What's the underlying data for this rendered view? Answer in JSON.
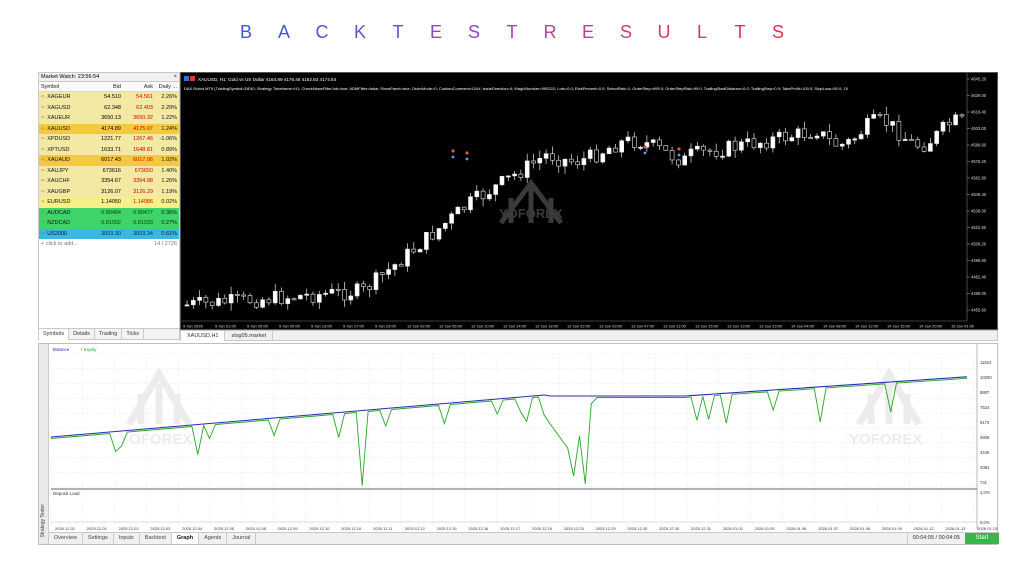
{
  "banner": {
    "letters": [
      {
        "ch": "B",
        "color": "#3b5bdb"
      },
      {
        "ch": "A",
        "color": "#4a56d6"
      },
      {
        "ch": "C",
        "color": "#5a52d2"
      },
      {
        "ch": "K",
        "color": "#6a4ece"
      },
      {
        "ch": "T",
        "color": "#7a4aca"
      },
      {
        "ch": "E",
        "color": "#8a47c4"
      },
      {
        "ch": "S",
        "color": "#9b44bd"
      },
      {
        "ch": "T",
        "color": "#ab40b3"
      },
      {
        "ch": "R",
        "color": "#b83ca6"
      },
      {
        "ch": "E",
        "color": "#c23a96"
      },
      {
        "ch": "S",
        "color": "#cc3786"
      },
      {
        "ch": "U",
        "color": "#d43476"
      },
      {
        "ch": "L",
        "color": "#da3266"
      },
      {
        "ch": "T",
        "color": "#df3158"
      },
      {
        "ch": "S",
        "color": "#e2304c"
      }
    ]
  },
  "market_watch": {
    "title": "Market Watch: 23:56:54",
    "close": "×",
    "columns": {
      "symbol": "Symbol",
      "bid": "Bid",
      "ask": "Ask",
      "daily": "Daily ..."
    },
    "rows": [
      {
        "symbol": "XAGEUR",
        "bid": "54.510",
        "ask": "54.561",
        "daily": "2.26%",
        "bg": "#f3e9a3",
        "bidc": "#000",
        "askc": "#d40000"
      },
      {
        "symbol": "XAGUSD",
        "bid": "62.348",
        "ask": "62.403",
        "daily": "2.29%",
        "bg": "#f3e9a3",
        "bidc": "#000",
        "askc": "#d40000"
      },
      {
        "symbol": "XAUEUR",
        "bid": "3650.13",
        "ask": "3650.32",
        "daily": "1.22%",
        "bg": "#f3e9a3",
        "bidc": "#000",
        "askc": "#d40000"
      },
      {
        "symbol": "XAUUSD",
        "bid": "4174.89",
        "ask": "4175.07",
        "daily": "1.24%",
        "bg": "#f5c842",
        "bidc": "#000",
        "askc": "#d40000"
      },
      {
        "symbol": "XPDUSD",
        "bid": "1221.77",
        "ask": "1267.46",
        "daily": "-1.06%",
        "bg": "#f3e9a3",
        "bidc": "#000",
        "askc": "#d40000"
      },
      {
        "symbol": "XPTUSD",
        "bid": "1633.71",
        "ask": "1648.81",
        "daily": "0.89%",
        "bg": "#f3e9a3",
        "bidc": "#000",
        "askc": "#d40000"
      },
      {
        "symbol": "XAUAUD",
        "bid": "6017.43",
        "ask": "6017.06",
        "daily": "1.02%",
        "bg": "#f5c842",
        "bidc": "#000",
        "askc": "#d40000"
      },
      {
        "symbol": "XAUJPY",
        "bid": "673616",
        "ask": "673650",
        "daily": "1.40%",
        "bg": "#f3e9a3",
        "bidc": "#000",
        "askc": "#d40000"
      },
      {
        "symbol": "XAUCHF",
        "bid": "3354.67",
        "ask": "3354.98",
        "daily": "1.26%",
        "bg": "#f3e9a3",
        "bidc": "#000",
        "askc": "#d40000"
      },
      {
        "symbol": "XAUGBP",
        "bid": "3126.07",
        "ask": "3126.29",
        "daily": "1.19%",
        "bg": "#f3e9a3",
        "bidc": "#000",
        "askc": "#d40000"
      },
      {
        "symbol": "EURUSD",
        "bid": "1.14050",
        "ask": "1.14086",
        "daily": "0.02%",
        "bg": "#f7f08a",
        "bidc": "#000",
        "askc": "#d40000"
      },
      {
        "symbol": "AUDCAD",
        "bid": "0.89484",
        "ask": "0.89477",
        "daily": "0.36%",
        "bg": "#3fd46a",
        "bidc": "#0a3a12",
        "askc": "#0a3a12"
      },
      {
        "symbol": "NZDCAD",
        "bid": "0.81002",
        "ask": "0.81033",
        "daily": "0.27%",
        "bg": "#3fd46a",
        "bidc": "#0a3a12",
        "askc": "#0a3a12"
      },
      {
        "symbol": "US2000",
        "bid": "3003.30",
        "ask": "3003.34",
        "daily": "0.61%",
        "bg": "#39b8e8",
        "bidc": "#002a40",
        "askc": "#002a40"
      }
    ],
    "add_label": "+ click to add...",
    "count": "14 / 2726",
    "tabs": [
      "Symbols",
      "Details",
      "Trading",
      "Ticks"
    ]
  },
  "chart": {
    "symbol_line": "XAUUSD, H1:  Gold vs US Dollar  4164.89 4176.46 4162.83 4174.54",
    "ea_line": "DAX Robot MT5 (TradingSymbol=DE40; Strategy Timeframe=H1; CheckNewsFilterJob=true; ADMFilter=false; ShowPanel=true; OrderMode=0; CustomComment=DAX; tradeDirection=4; MagicNumber=990222; Lots=0.0; RiskPercent=0.0; SelectRisk=1; OrderStep=699.0; OrderStepRisk=99.0; TrailingStartDistance=0.0; TrailingStep=0.0; TakeProfit=100.0; StopLoss=50.0; 15",
    "watermark": "YOFOREX",
    "price_labels": [
      "4645.20",
      "4629.00",
      "4616.40",
      "4603.00",
      "4589.60",
      "4576.20",
      "4562.80",
      "4549.40",
      "4536.00",
      "4522.60",
      "4509.20",
      "4495.80",
      "4482.40",
      "4469.00",
      "4455.60"
    ],
    "time_labels": [
      "9 Jan 2026",
      "9 Jan 01:00",
      "9 Jan 05:00",
      "9 Jan 09:00",
      "9 Jan 13:00",
      "9 Jan 17:00",
      "9 Jan 23:00",
      "12 Jan 02:00",
      "12 Jan 06:00",
      "12 Jan 10:00",
      "12 Jan 14:00",
      "12 Jan 18:00",
      "12 Jan 22:00",
      "13 Jan 03:00",
      "13 Jan 07:00",
      "13 Jan 11:00",
      "13 Jan 15:00",
      "13 Jan 19:00",
      "13 Jan 23:00",
      "14 Jan 04:00",
      "14 Jan 08:00",
      "14 Jan 12:00",
      "14 Jan 16:00",
      "14 Jan 20:00",
      "15 Jan 01:00"
    ],
    "tabs": [
      "XAUUSD,H1",
      "stsg05.market"
    ]
  },
  "tester": {
    "legend": [
      "Balance",
      "Equity"
    ],
    "watermark": "YOFOREX",
    "y_labels": [
      "11622",
      "10250",
      "8897",
      "7524",
      "6172",
      "4809",
      "3446",
      "2084",
      "731"
    ],
    "deposit_label": "Deposit Load",
    "deposit_y": [
      "1.0%",
      "0.0%"
    ],
    "x_labels": [
      "2025.12.01",
      "2025.12.01",
      "2025.12.02",
      "2025.12.03",
      "2025.12.04",
      "2025.12.05",
      "2025.12.08",
      "2025.12.09",
      "2025.12.10",
      "2025.12.10",
      "2025.12.11",
      "2025.12.12",
      "2025.12.15",
      "2025.12.16",
      "2025.12.17",
      "2025.12.19",
      "2025.12.23",
      "2025.12.29",
      "2025.12.30",
      "2025.12.30",
      "2025.12.31",
      "2026.01.02",
      "2026.01.05",
      "2026.01.06",
      "2026.01.07",
      "2026.01.08",
      "2026.01.09",
      "2026.01.12",
      "2026.01.13",
      "2026.01.15"
    ],
    "side_label": "Strategy Tester",
    "tabs": [
      "Overview",
      "Settings",
      "Inputs",
      "Backtest",
      "Graph",
      "Agents",
      "Journal"
    ],
    "active_tab": "Graph",
    "time": "00:04:05 / 00:04:05",
    "start_label": "Start",
    "colors": {
      "balance": "#2a2ab8",
      "equity": "#22a822"
    }
  }
}
